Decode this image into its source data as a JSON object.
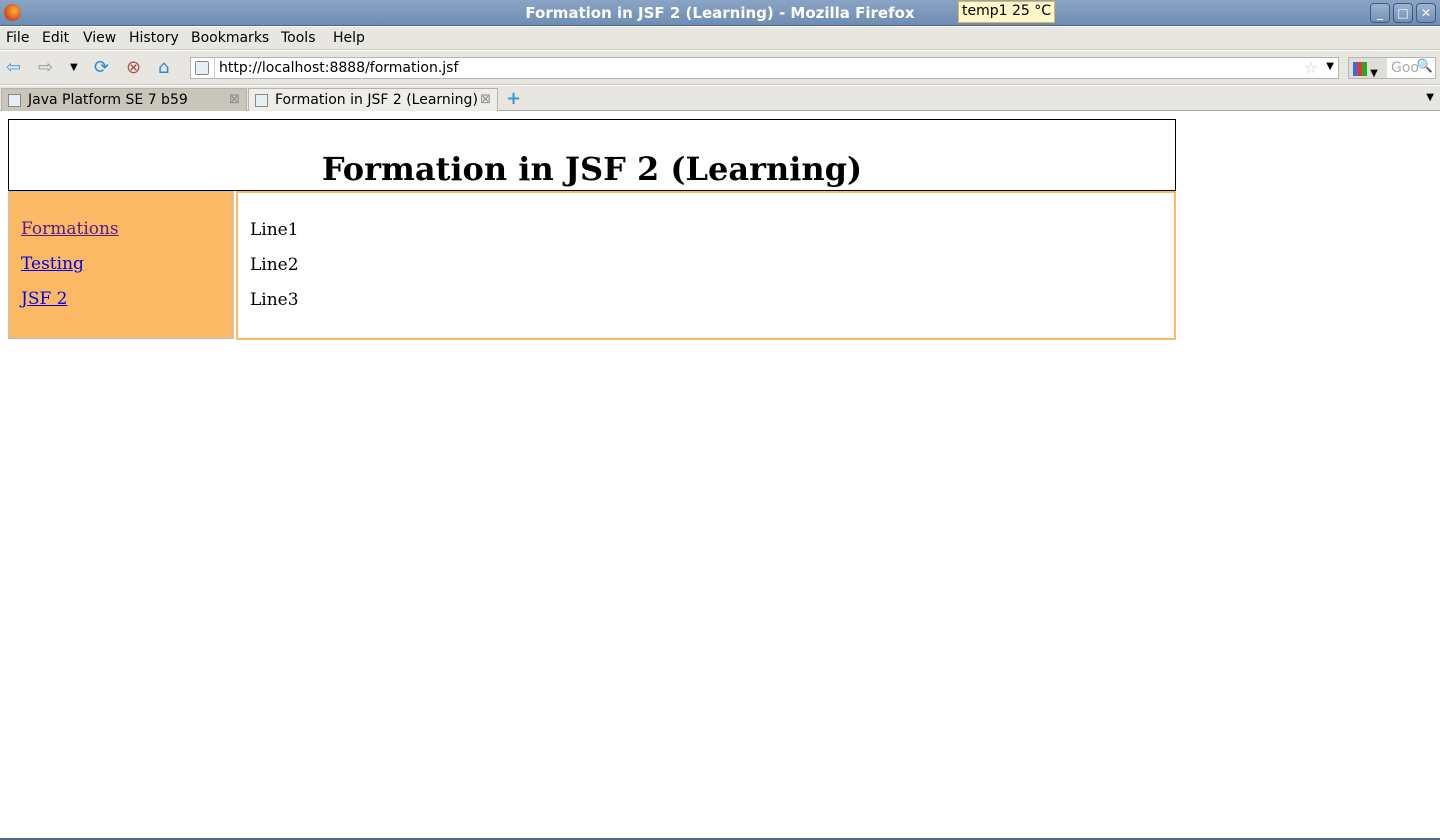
{
  "window": {
    "title": "Formation in JSF 2 (Learning) - Mozilla Firefox",
    "temp_widget": "temp1 25 °C"
  },
  "menu": [
    "File",
    "Edit",
    "View",
    "History",
    "Bookmarks",
    "Tools",
    "Help"
  ],
  "nav": {
    "url": "http://localhost:8888/formation.jsf",
    "search_placeholder": "Google"
  },
  "tabs": [
    {
      "label": "Java Platform SE 7 b59",
      "active": false
    },
    {
      "label": "Formation in JSF 2 (Learning)",
      "active": true
    }
  ],
  "page": {
    "heading": "Formation in JSF 2 (Learning)",
    "sidebar_links": [
      {
        "label": "Formations",
        "visited": true
      },
      {
        "label": "Testing",
        "visited": false
      },
      {
        "label": "JSF 2",
        "visited": false
      }
    ],
    "content_lines": [
      "Line1",
      "Line2",
      "Line3"
    ]
  },
  "colors": {
    "sidebar_bg": "#fbb965",
    "link": "#0000ee",
    "visited_link": "#551a8b"
  }
}
